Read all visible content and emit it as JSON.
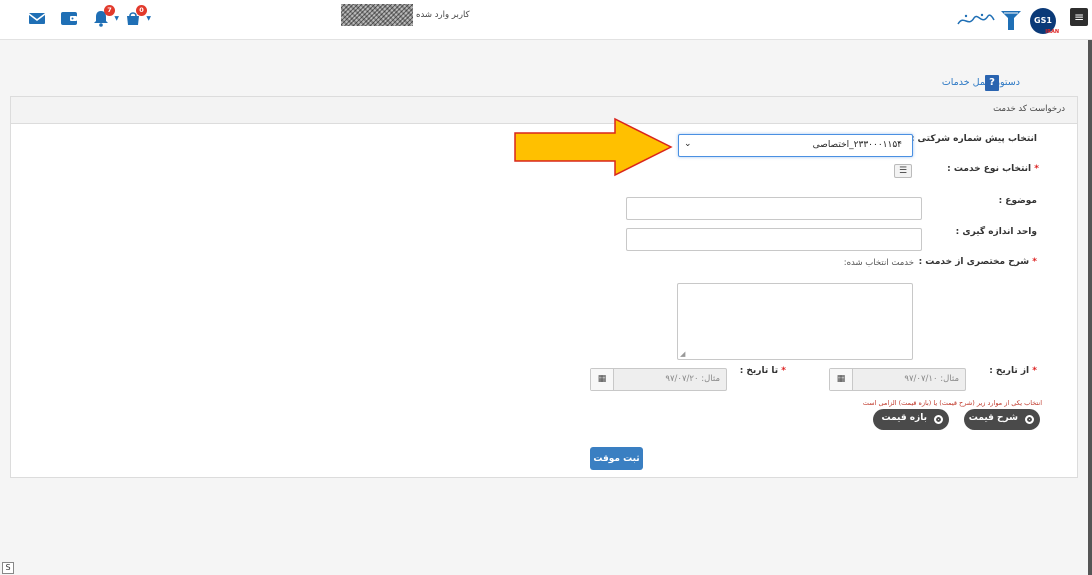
{
  "header": {
    "user_label": "کاربر وارد شده",
    "gs1_text": "GS1",
    "gs1_tag": "IRAN",
    "notifications": [
      {
        "icon": "cart-icon",
        "badge": "0"
      },
      {
        "icon": "bell-icon",
        "badge": "7"
      },
      {
        "icon": "wallet-icon"
      },
      {
        "icon": "envelope-icon"
      }
    ],
    "menu_icon": "hamburger-icon"
  },
  "help": {
    "link_text": "دستورالعمل خدمات",
    "badge": "?"
  },
  "panel": {
    "title": "درخواست کد خدمت"
  },
  "form": {
    "prefix_label": "انتخاب پیش شماره شرکتی :",
    "prefix_value": "۲۳۳۰۰۰۱۱۵۴_اختصاصی",
    "service_type_label": "انتخاب نوع خدمت :",
    "subject_label": "موضوع :",
    "unit_label": "واحد اندازه گیری :",
    "description_label": "شرح مختصری از خدمت :",
    "selected_service_hint": "خدمت انتخاب شده:",
    "from_date_label": "از تاریخ :",
    "from_date_placeholder": "مثال: ۹۷/۰۷/۱۰",
    "to_date_label": "تا تاریخ :",
    "to_date_placeholder": "مثال: ۹۷/۰۷/۲۰",
    "price_warning": "انتخاب یکی از موارد زیر (شرح قیمت) یا (بازه قیمت) الزامی است",
    "price_description_option": "شرح قیمت",
    "price_range_option": "بازه قیمت",
    "save_button": "ثبت موقت",
    "required_mark": "*"
  },
  "misc": {
    "corner_glyph": "S"
  },
  "colors": {
    "accent": "#3a7fc2",
    "badge": "#e23a2c",
    "arrow_fill": "#ffc000",
    "arrow_stroke": "#d9261c"
  }
}
